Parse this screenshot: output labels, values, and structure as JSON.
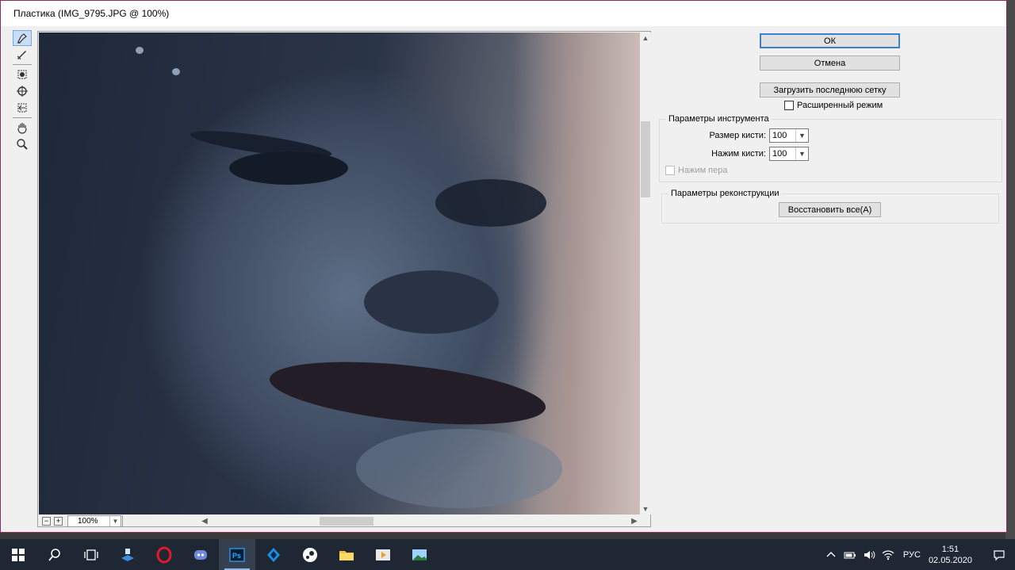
{
  "window": {
    "title": "Пластика (IMG_9795.JPG @ 100%)"
  },
  "tools": [
    {
      "name": "forward-warp-tool-icon",
      "active": true
    },
    {
      "name": "reconstruct-tool-icon",
      "active": false
    },
    {
      "name": "pucker-tool-icon",
      "active": false
    },
    {
      "name": "bloat-tool-icon",
      "active": false
    },
    {
      "name": "push-left-tool-icon",
      "active": false
    },
    {
      "name": "hand-tool-icon",
      "active": false
    },
    {
      "name": "zoom-tool-icon",
      "active": false
    }
  ],
  "preview": {
    "zoom_value": "100%",
    "zoom_out_label": "−",
    "zoom_in_label": "+"
  },
  "buttons": {
    "ok": "ОК",
    "cancel": "Отмена",
    "load_mesh": "Загрузить последнюю сетку",
    "restore_all": "Восстановить все(A)"
  },
  "advanced_mode": {
    "label": "Расширенный режим",
    "checked": false
  },
  "tool_options": {
    "title": "Параметры инструмента",
    "brush_size_label": "Размер кисти:",
    "brush_size_value": "100",
    "brush_pressure_label": "Нажим кисти:",
    "brush_pressure_value": "100",
    "stylus_pressure_label": "Нажим пера"
  },
  "reconstruct_options": {
    "title": "Параметры реконструкции"
  },
  "taskbar": {
    "apps": [
      "windows-start-icon",
      "search-icon",
      "task-view-icon",
      "file-transfer-icon",
      "opera-icon",
      "discord-icon",
      "photoshop-icon",
      "game-app-icon",
      "steam-icon",
      "file-explorer-icon",
      "media-player-icon",
      "image-viewer-icon"
    ],
    "photoshop_label": "Ps",
    "language": "РУС",
    "time": "1:51",
    "date": "02.05.2020"
  }
}
